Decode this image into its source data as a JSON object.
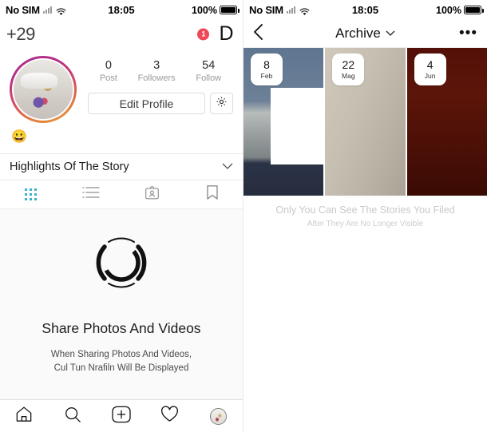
{
  "left": {
    "status": {
      "carrier": "No SIM",
      "time": "18:05",
      "battery": "100%"
    },
    "topnav": {
      "left_label": "+29",
      "badge": "1",
      "right_letter": "D"
    },
    "profile": {
      "stats": [
        {
          "num": "0",
          "label": "Post"
        },
        {
          "num": "3",
          "label": "Followers"
        },
        {
          "num": "54",
          "label": "Follow"
        }
      ],
      "edit_button": "Edit Profile",
      "settings_icon": "gear-icon",
      "bio_emoji": "😀"
    },
    "highlights": {
      "label": "Highlights Of The Story",
      "chevron": "⌄"
    },
    "tabs": [
      {
        "name": "grid-tab",
        "icon": "grid-icon",
        "active": true
      },
      {
        "name": "list-tab",
        "icon": "list-icon",
        "active": false
      },
      {
        "name": "tagged-tab",
        "icon": "person-card-icon",
        "active": false
      },
      {
        "name": "saved-tab",
        "icon": "bookmark-icon",
        "active": false
      }
    ],
    "empty_state": {
      "icon": "camera-icon",
      "title": "Share Photos And Videos",
      "subtitle_line1": "When Sharing Photos And Videos,",
      "subtitle_line2": "Cul Tun Nrafiln Will Be Displayed"
    },
    "bottomnav": [
      {
        "name": "home-icon"
      },
      {
        "name": "search-icon"
      },
      {
        "name": "add-post-icon"
      },
      {
        "name": "activity-heart-icon"
      },
      {
        "name": "profile-avatar-icon"
      }
    ]
  },
  "right": {
    "status": {
      "carrier": "No SIM",
      "time": "18:05",
      "battery": "100%"
    },
    "topnav": {
      "back": "‹",
      "title": "Archive",
      "chevron": "⌄",
      "menu": "•••"
    },
    "archive_cards": [
      {
        "day": "8",
        "month": "Feb"
      },
      {
        "day": "22",
        "month": "Mag"
      },
      {
        "day": "4",
        "month": "Jun"
      }
    ],
    "note_line1": "Only You Can See The Stories You Filed",
    "note_line2": "After They Are No Longer Visible"
  },
  "colors": {
    "accent_teal": "#37b3c9",
    "badge_red": "#ed4956",
    "ring_start": "#a0318f",
    "ring_end": "#e8a33d"
  }
}
